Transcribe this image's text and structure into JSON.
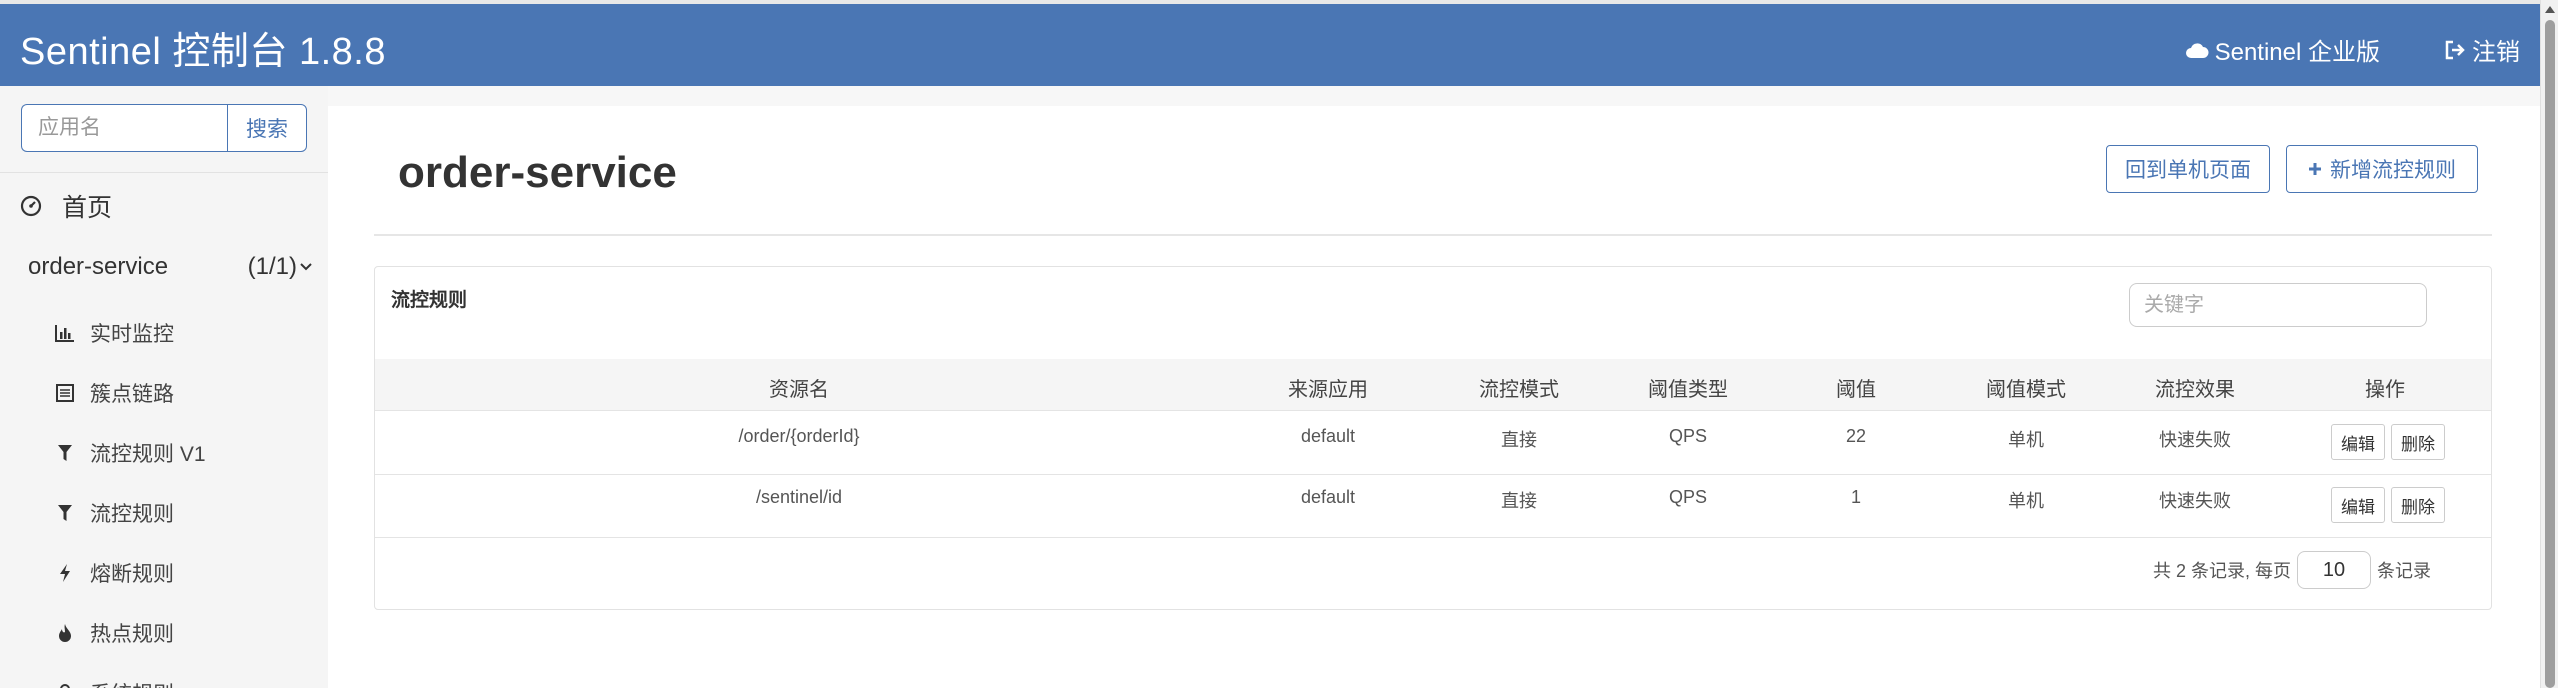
{
  "navbar": {
    "brand": "Sentinel 控制台 1.8.8",
    "enterprise_label": "Sentinel 企业版",
    "logout_label": "注销"
  },
  "sidebar": {
    "search_placeholder": "应用名",
    "search_button": "搜索",
    "home_label": "首页",
    "app": {
      "name": "order-service",
      "count": "(1/1)"
    },
    "items": [
      {
        "label": "实时监控",
        "icon": "bar-chart-icon"
      },
      {
        "label": "簇点链路",
        "icon": "list-icon"
      },
      {
        "label": "流控规则 V1",
        "icon": "filter-icon"
      },
      {
        "label": "流控规则",
        "icon": "filter-icon"
      },
      {
        "label": "熔断规则",
        "icon": "flash-icon"
      },
      {
        "label": "热点规则",
        "icon": "fire-icon"
      },
      {
        "label": "系统规则",
        "icon": "lock-icon"
      }
    ]
  },
  "main": {
    "title": "order-service",
    "back_button": "回到单机页面",
    "add_button": "新增流控规则"
  },
  "panel": {
    "title": "流控规则",
    "keyword_placeholder": "关键字",
    "columns": [
      "资源名",
      "来源应用",
      "流控模式",
      "阈值类型",
      "阈值",
      "阈值模式",
      "流控效果",
      "操作"
    ],
    "rows": [
      [
        "/order/{orderId}",
        "default",
        "直接",
        "QPS",
        "22",
        "单机",
        "快速失败"
      ],
      [
        "/sentinel/id",
        "default",
        "直接",
        "QPS",
        "1",
        "单机",
        "快速失败"
      ]
    ],
    "edit_label": "编辑",
    "delete_label": "删除",
    "pager": {
      "prefix": "共 2 条记录, 每页",
      "page_size": "10",
      "suffix": "条记录"
    }
  },
  "colors": {
    "navbar": "#4a76b4",
    "accent": "#4a76b4"
  }
}
